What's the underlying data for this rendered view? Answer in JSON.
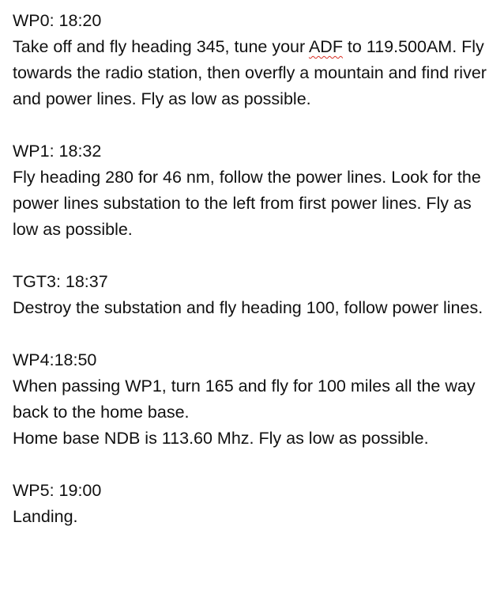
{
  "document": {
    "sections": [
      {
        "heading": "WP0: 18:20",
        "paragraphs": [
          {
            "before": "Take off and fly heading 345, tune your ",
            "flagged": "ADF",
            "after": " to 119.500AM. Fly towards the radio station, then overfly a mountain and find river and power lines. Fly as low as possible."
          }
        ]
      },
      {
        "heading": "WP1: 18:32",
        "paragraphs": [
          "Fly heading 280 for 46 nm, follow the power lines. Look for the power lines substation to the left from first power lines. Fly as low as possible."
        ]
      },
      {
        "heading": "TGT3: 18:37",
        "paragraphs": [
          "Destroy the substation and fly heading 100, follow power lines."
        ]
      },
      {
        "heading": "WP4:18:50",
        "paragraphs": [
          "When passing WP1, turn 165 and fly for 100 miles all the way back to the home base.",
          "Home base NDB is 113.60 Mhz. Fly as low as possible."
        ]
      },
      {
        "heading": "WP5: 19:00",
        "paragraphs": [
          "Landing."
        ]
      }
    ],
    "spellcheck_underline_color": "#d93025",
    "text_color": "#111111"
  }
}
